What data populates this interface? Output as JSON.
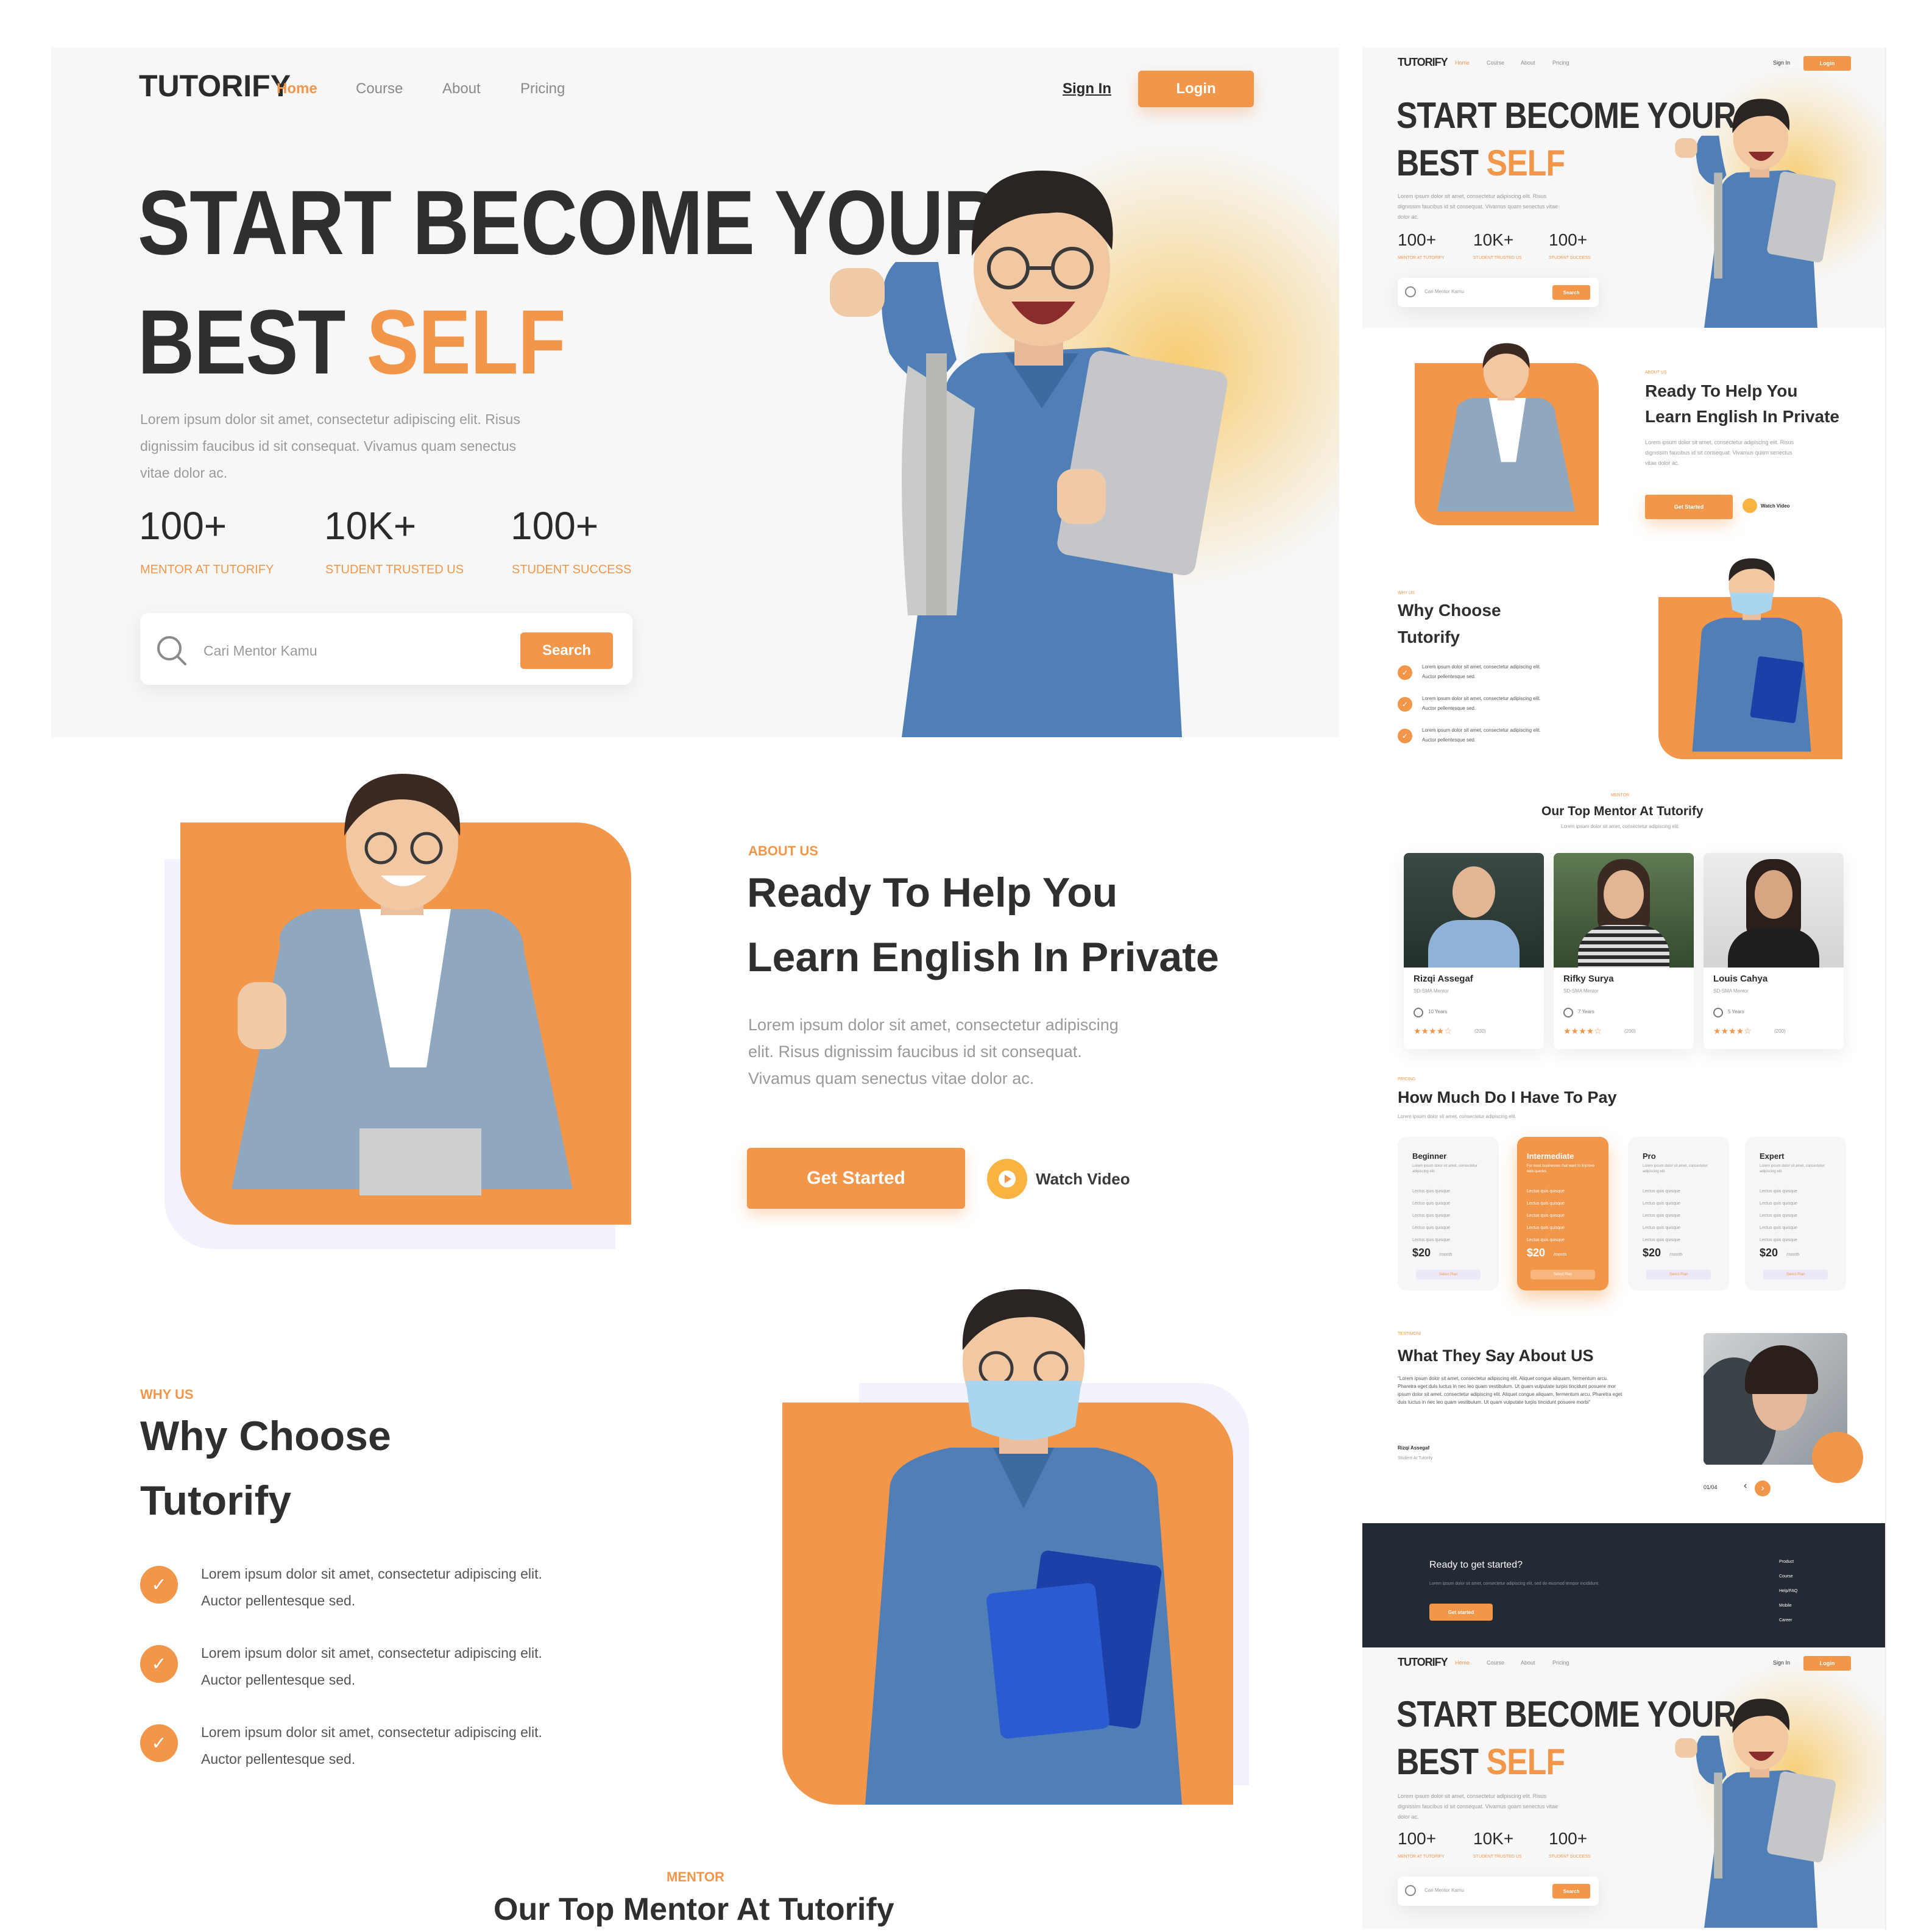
{
  "brand": "TUTORIFY",
  "nav": {
    "home": "Home",
    "course": "Course",
    "about": "About",
    "pricing": "Pricing",
    "signin": "Sign In",
    "login": "Login"
  },
  "hero": {
    "title_line1": "START BECOME YOUR",
    "title_line2_a": "BEST",
    "title_line2_b": "SELF",
    "desc": "Lorem ipsum dolor sit amet, consectetur adipiscing elit. Risus dignissim faucibus id sit consequat. Vivamus quam senectus vitae dolor ac.",
    "stats": [
      {
        "value": "100+",
        "label": "MENTOR AT TUTORIFY"
      },
      {
        "value": "10K+",
        "label": "STUDENT TRUSTED US"
      },
      {
        "value": "100+",
        "label": "STUDENT SUCCESS"
      }
    ],
    "search_placeholder": "Cari Mentor Kamu",
    "search_button": "Search"
  },
  "about": {
    "eyebrow": "ABOUT US",
    "title_line1": "Ready To Help You",
    "title_line2": "Learn English In Private",
    "desc": "Lorem ipsum dolor sit amet, consectetur adipiscing elit. Risus dignissim faucibus id sit consequat. Vivamus quam senectus vitae dolor ac.",
    "cta": "Get Started",
    "video": "Watch Video"
  },
  "why": {
    "eyebrow": "WHY US",
    "title_line1": "Why Choose",
    "title_line2": "Tutorify",
    "items": [
      {
        "line1": "Lorem ipsum dolor sit amet, consectetur adipiscing elit.",
        "line2": "Auctor pellentesque sed."
      },
      {
        "line1": "Lorem ipsum dolor sit amet, consectetur adipiscing elit.",
        "line2": "Auctor pellentesque sed."
      },
      {
        "line1": "Lorem ipsum dolor sit amet, consectetur adipiscing elit.",
        "line2": "Auctor pellentesque sed."
      }
    ]
  },
  "mentor": {
    "eyebrow": "MENTOR",
    "title": "Our Top Mentor At Tutorify",
    "subtitle": "Lorem ipsum dolor sit amet, consectetur adipiscing elit.",
    "cards": [
      {
        "name": "Rizqi Assegaf",
        "role": "SD-SMA Mentor",
        "years": "10 Years",
        "stars": "★★★★☆",
        "reviews": "(200)"
      },
      {
        "name": "Rifky Surya",
        "role": "SD-SMA Mentor",
        "years": "7 Years",
        "stars": "★★★★☆",
        "reviews": "(200)"
      },
      {
        "name": "Louis Cahya",
        "role": "SD-SMA Mentor",
        "years": "5 Years",
        "stars": "★★★★☆",
        "reviews": "(200)"
      }
    ]
  },
  "pricing": {
    "eyebrow": "PRICING",
    "title": "How Much Do I Have To Pay",
    "subtitle": "Lorem ipsum dolor sit amet, consectetur adipiscing elit.",
    "plans": [
      {
        "name": "Beginner",
        "desc": "Lorem ipsum dolor sit amet, consectetur adipiscing elit.",
        "features": [
          "Lectus quis quisque",
          "Lectus quis quisque",
          "Lectus quis quisque",
          "Lectus quis quisque",
          "Lectus quis quisque"
        ],
        "price": "$20",
        "period": "/month",
        "button": "Select Plan"
      },
      {
        "name": "Intermediate",
        "desc": "For most businesses that want to improve web queries",
        "features": [
          "Lectus quis quisque",
          "Lectus quis quisque",
          "Lectus quis quisque",
          "Lectus quis quisque",
          "Lectus quis quisque"
        ],
        "price": "$20",
        "period": "/month",
        "button": "Select Plan"
      },
      {
        "name": "Pro",
        "desc": "Lorem ipsum dolor sit amet, consectetur adipiscing elit.",
        "features": [
          "Lectus quis quisque",
          "Lectus quis quisque",
          "Lectus quis quisque",
          "Lectus quis quisque",
          "Lectus quis quisque"
        ],
        "price": "$20",
        "period": "/month",
        "button": "Select Plan"
      },
      {
        "name": "Expert",
        "desc": "Lorem ipsum dolor sit amet, consectetur adipiscing elit.",
        "features": [
          "Lectus quis quisque",
          "Lectus quis quisque",
          "Lectus quis quisque",
          "Lectus quis quisque",
          "Lectus quis quisque"
        ],
        "price": "$20",
        "period": "/month",
        "button": "Select Plan"
      }
    ]
  },
  "testimonial": {
    "eyebrow": "TESTIMONI",
    "title": "What They Say About US",
    "quote": "\"Lorem ipsum dolor sit amet, consectetur adipiscing elit. Aliquet congue aliquam, fermentum arcu. Pharetra eget duis luctus in nec leo quam vestibulum. Ut quam vulputate turpis tincidunt posuere mor ipsum dolor sit amet, consectetur adipiscing elit. Aliquet congue aliquam, fermentum arcu. Pharetra eget duis luctus in nec leo quam vestibulum. Ut quam vulputate turpis tincidunt posuere morbi\"",
    "author": "Rizqi Assegaf",
    "author_role": "Student At Tutorify",
    "counter": "01/04",
    "prev": "‹",
    "next": "›"
  },
  "footer": {
    "cta_title": "Ready to get started?",
    "cta_desc": "Lorem ipsum dolor sit amet, consectetur adipiscing elit, sed do eiusmod tempor incididunt.",
    "cta_button": "Get started",
    "links": [
      "Product",
      "Course",
      "Help/FAQ",
      "Mobile",
      "Career"
    ]
  },
  "colors": {
    "accent": "#F2964A",
    "dark": "#2b2b2b",
    "footer": "#232A33",
    "denim": "#4F7FB6",
    "cardigan": "#8FA7BF",
    "mask": "#A9D5EE",
    "notebook": "#1D3FA8"
  }
}
